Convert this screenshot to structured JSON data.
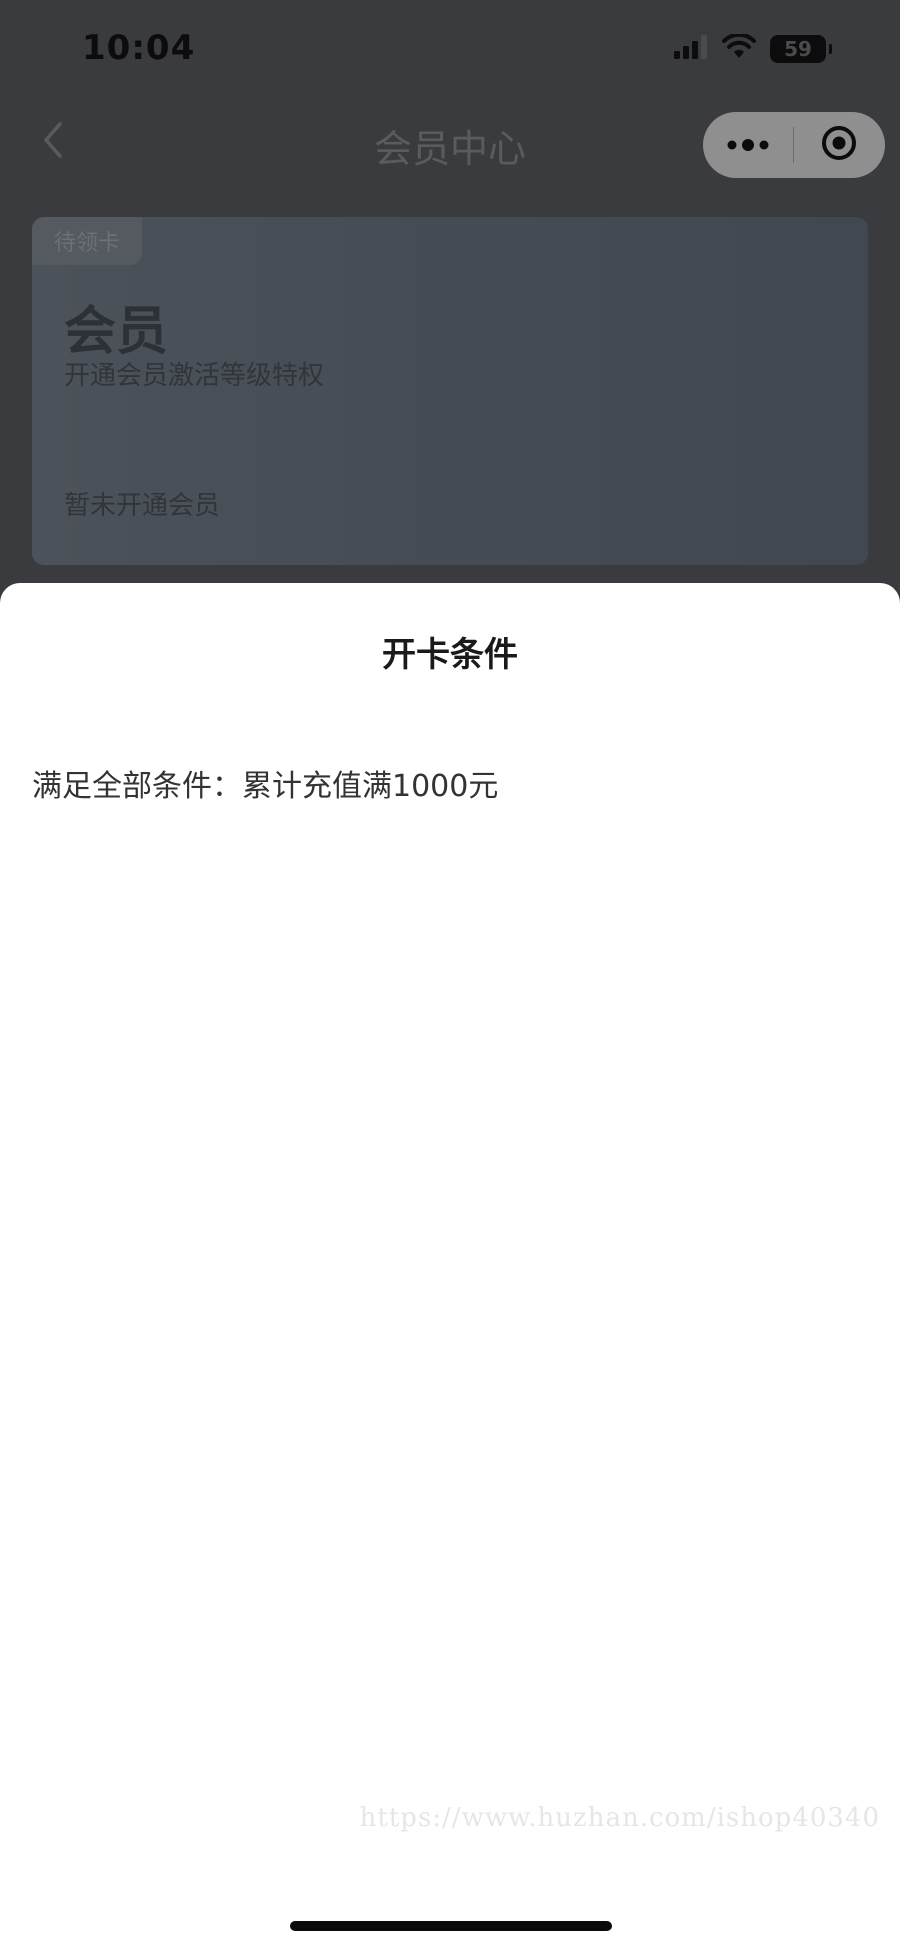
{
  "status_bar": {
    "time": "10:04",
    "battery": "59"
  },
  "nav": {
    "title": "会员中心",
    "back_icon": "chevron-left-icon",
    "more_icon": "more-dots-icon",
    "close_icon": "target-circle-icon"
  },
  "card": {
    "tag": "待领卡",
    "title": "会员",
    "subtitle": "开通会员激活等级特权",
    "status": "暂未开通会员"
  },
  "sheet": {
    "title": "开卡条件",
    "condition": "满足全部条件：累计充值满1000元"
  },
  "watermark": "https://www.huzhan.com/ishop40340",
  "colors": {
    "overlay": "#2a2b2d",
    "sheet_bg": "#ffffff",
    "capsule": "#8f8f90"
  }
}
